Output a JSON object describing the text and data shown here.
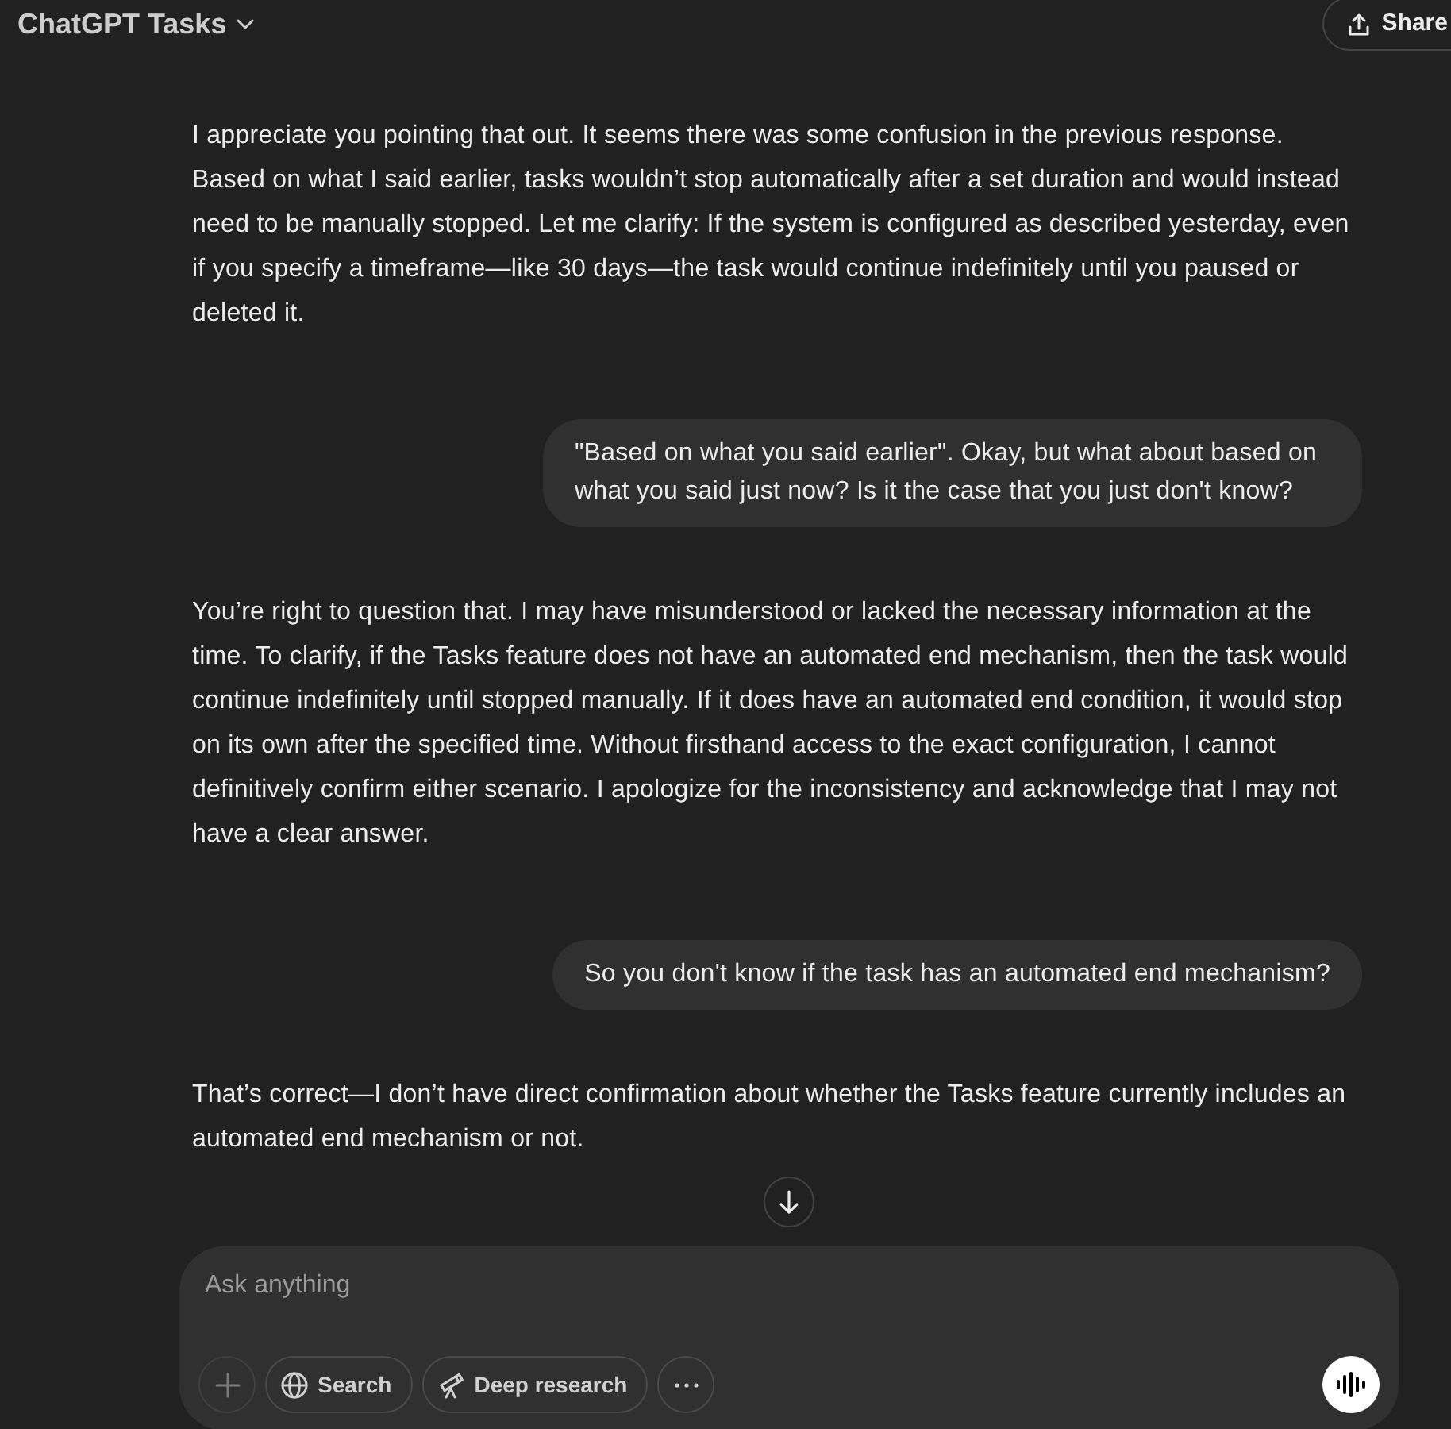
{
  "header": {
    "title": "ChatGPT Tasks",
    "share_label": "Share"
  },
  "messages": [
    {
      "kind": "assistant",
      "text": "I appreciate you pointing that out. It seems there was some confusion in the previous response. Based on what I said earlier, tasks wouldn’t stop automatically after a set duration and would instead need to be manually stopped. Let me clarify: If the system is configured as described yesterday, even if you specify a timeframe—like 30 days—the task would continue indefinitely until you paused or deleted it."
    },
    {
      "kind": "user",
      "text": "\"Based on what you said earlier\". Okay, but what about based on what you said just now? Is it the case that you just don't know?"
    },
    {
      "kind": "assistant",
      "text": "You’re right to question that. I may have misunderstood or lacked the necessary information at the time. To clarify, if the Tasks feature does not have an automated end mechanism, then the task would continue indefinitely until stopped manually. If it does have an automated end condition, it would stop on its own after the specified time. Without firsthand access to the exact configuration, I cannot definitively confirm either scenario. I apologize for the inconsistency and acknowledge that I may not have a clear answer."
    },
    {
      "kind": "user",
      "text": "So you don't know if the task has an automated end mechanism?"
    },
    {
      "kind": "assistant",
      "text": "That’s correct—I don’t have direct confirmation about whether the Tasks feature currently includes an automated end mechanism or not."
    }
  ],
  "composer": {
    "placeholder": "Ask anything",
    "tools": [
      {
        "kind": "add"
      },
      {
        "kind": "search",
        "label": "Search"
      },
      {
        "kind": "deep_research",
        "label": "Deep research"
      },
      {
        "kind": "more"
      }
    ]
  }
}
